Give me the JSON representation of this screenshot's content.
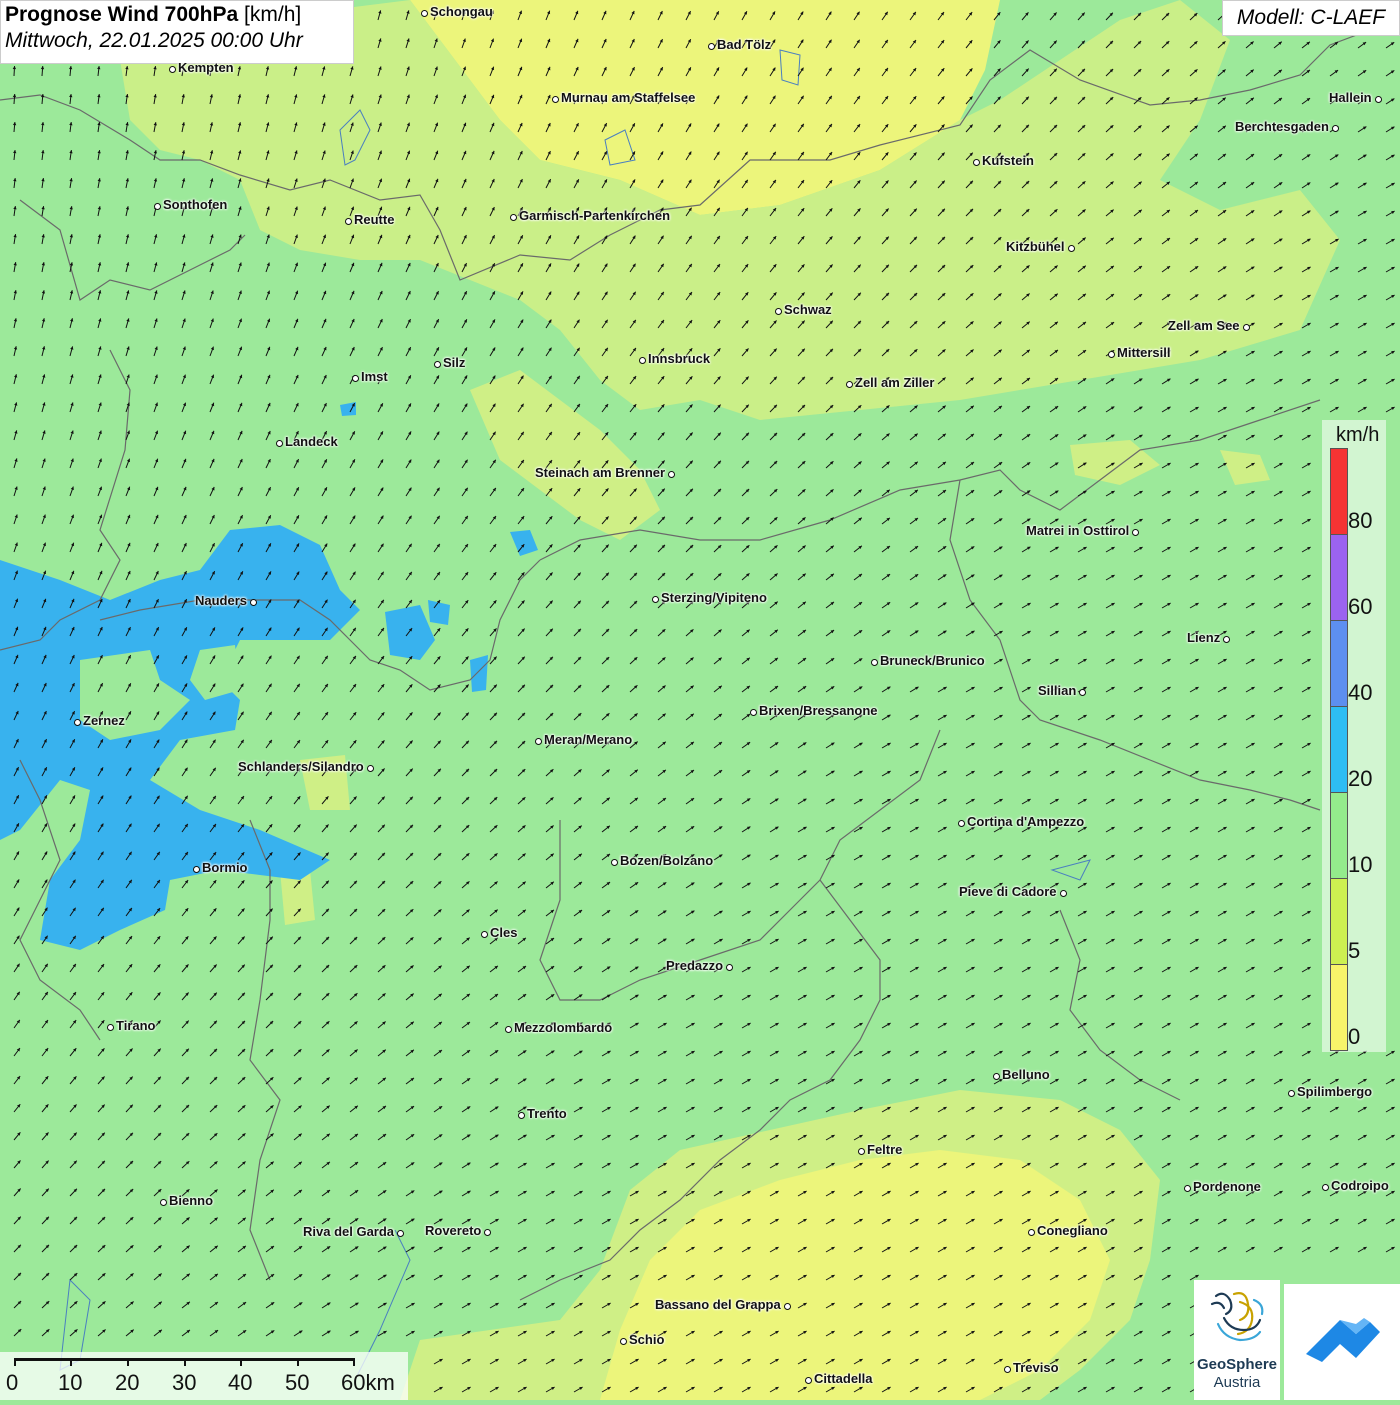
{
  "header": {
    "title_bold": "Prognose Wind 700hPa",
    "title_unit": "[km/h]",
    "date_line": "Mittwoch, 22.01.2025 00:00 Uhr",
    "model": "Modell: C-LAEF"
  },
  "legend": {
    "unit": "km/h",
    "ticks": [
      "80",
      "60",
      "40",
      "20",
      "10",
      "5",
      "0"
    ],
    "colors": [
      "#f53333",
      "#9b63ef",
      "#5d8ff0",
      "#2ebdf3",
      "#94eb8c",
      "#cdf051",
      "#f8f46a"
    ]
  },
  "scale": {
    "labels": [
      "0",
      "10",
      "20",
      "30",
      "40",
      "50",
      "60km"
    ]
  },
  "logos": {
    "geosphere_line1": "GeoSphere",
    "geosphere_line2": "Austria",
    "geosphere_icon": "geosphere-logo",
    "second_icon": "wind-cloud-logo"
  },
  "palette": {
    "green": "#9ce99a",
    "yellow": "#ecf57b",
    "yellowgreen": "#cfef86",
    "blue": "#38b2ee",
    "arrow": "#111111"
  },
  "cities": [
    {
      "name": "Schongau"
    },
    {
      "name": "Bad Tölz"
    },
    {
      "name": "Kempten"
    },
    {
      "name": "Murnau am Staffelsee"
    },
    {
      "name": "Hallein"
    },
    {
      "name": "Berchtesgaden"
    },
    {
      "name": "Kufstein"
    },
    {
      "name": "Sonthofen"
    },
    {
      "name": "Reutte"
    },
    {
      "name": "Garmisch-Partenkirchen"
    },
    {
      "name": "Kitzbühel"
    },
    {
      "name": "Schwaz"
    },
    {
      "name": "Zell am See"
    },
    {
      "name": "Mittersill"
    },
    {
      "name": "Innsbruck"
    },
    {
      "name": "Silz"
    },
    {
      "name": "Imst"
    },
    {
      "name": "Zell am Ziller"
    },
    {
      "name": "Landeck"
    },
    {
      "name": "Steinach am Brenner"
    },
    {
      "name": "Matrei in Osttirol"
    },
    {
      "name": "Nauders"
    },
    {
      "name": "Sterzing/Vipiteno"
    },
    {
      "name": "Lienz"
    },
    {
      "name": "Bruneck/Brunico"
    },
    {
      "name": "Sillian"
    },
    {
      "name": "Brixen/Bressanone"
    },
    {
      "name": "Zernez"
    },
    {
      "name": "Meran/Merano"
    },
    {
      "name": "Schlanders/Silandro"
    },
    {
      "name": "Cortina d'Ampezzo"
    },
    {
      "name": "Bozen/Bolzano"
    },
    {
      "name": "Bormio"
    },
    {
      "name": "Pieve di Cadore"
    },
    {
      "name": "Cles"
    },
    {
      "name": "Predazzo"
    },
    {
      "name": "Tirano"
    },
    {
      "name": "Mezzolombardo"
    },
    {
      "name": "Belluno"
    },
    {
      "name": "Spilimbergo"
    },
    {
      "name": "Trento"
    },
    {
      "name": "Feltre"
    },
    {
      "name": "Pordenone"
    },
    {
      "name": "Codroipo"
    },
    {
      "name": "Bienno"
    },
    {
      "name": "Riva del Garda"
    },
    {
      "name": "Rovereto"
    },
    {
      "name": "Conegliano"
    },
    {
      "name": "Bassano del Grappa"
    },
    {
      "name": "Schio"
    },
    {
      "name": "Treviso"
    },
    {
      "name": "Cittadella"
    }
  ]
}
